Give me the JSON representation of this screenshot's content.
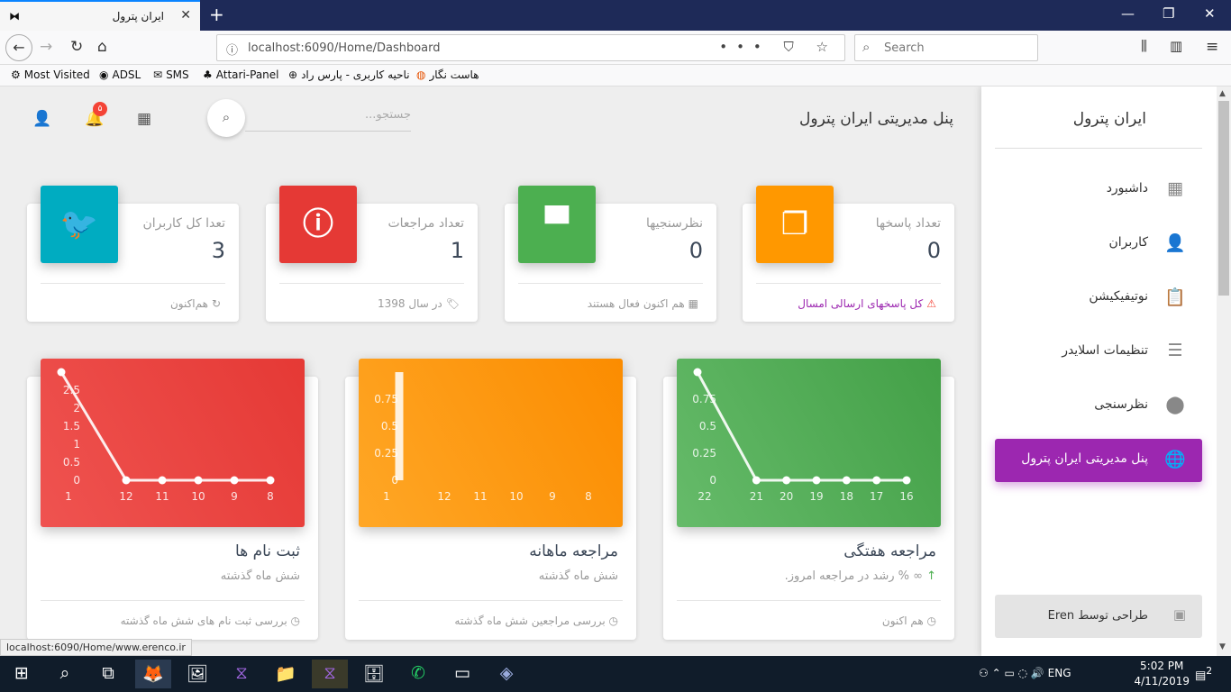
{
  "browser": {
    "tab_title": "ایران پترول",
    "tab_icon": "mask-icon",
    "new_tab": "+",
    "window_controls": [
      "—",
      "❐",
      "✕"
    ],
    "url": "localhost:6090/Home/Dashboard",
    "url_actions": "••• ⛉ ☆",
    "search_placeholder": "Search",
    "bookmarks": [
      {
        "icon": "⚙",
        "label": "Most Visited"
      },
      {
        "icon": "◉",
        "label": "ADSL"
      },
      {
        "icon": "✉",
        "label": "SMS"
      },
      {
        "icon": "♣",
        "label": "Attari-Panel"
      },
      {
        "icon": "⊕",
        "label": "ناحیه کاربری - پارس راد"
      },
      {
        "icon": "◍",
        "label": "هاست نگار"
      }
    ]
  },
  "header": {
    "title": "پنل مدیریتی ایران پترول",
    "search_placeholder": "جستجو...",
    "notification_count": "۵"
  },
  "sidebar": {
    "brand": "ایران پترول",
    "items": [
      {
        "label": "داشبورد",
        "icon": "▦"
      },
      {
        "label": "کاربران",
        "icon": "👤"
      },
      {
        "label": "نوتیفیکیشن",
        "icon": "📋"
      },
      {
        "label": "تنظیمات اسلایدر",
        "icon": "☰"
      },
      {
        "label": "نظرسنجی",
        "icon": "⬤"
      },
      {
        "label": "پنل مدیریتی ایران پترول",
        "icon": "🌐"
      }
    ],
    "credit": "طراحی توسط Eren"
  },
  "stats": [
    {
      "category": "تعداد پاسخها",
      "value": "0",
      "color": "#ff9800",
      "icon": "❐",
      "footer": "کل پاسخهای ارسالی امسال",
      "footer_icon": "⚠",
      "footer_color": "#9c27b0",
      "footer_icon_color": "#f44336"
    },
    {
      "category": "نظرسنجیها",
      "value": "0",
      "color": "#4caf50",
      "icon": "▀",
      "footer": "هم اکنون فعال هستند",
      "footer_icon": "▦",
      "footer_color": "#999",
      "footer_icon_color": "#999"
    },
    {
      "category": "تعداد مراجعات",
      "value": "1",
      "color": "#e53935",
      "icon": "ⓘ",
      "footer": "در سال 1398",
      "footer_icon": "🏷",
      "footer_color": "#999",
      "footer_icon_color": "#999"
    },
    {
      "category": "تعدا کل کاربران",
      "value": "3",
      "color": "#00acc1",
      "icon": "🐦",
      "footer": "هم‌اکنون",
      "footer_icon": "↻",
      "footer_color": "#999",
      "footer_icon_color": "#999"
    }
  ],
  "charts": [
    {
      "title": "مراجعه هفتگی",
      "subtitle": "∞ % رشد در مراجعه امروز.",
      "subtitle_icon": "↑",
      "footer": "هم اکنون",
      "footer_icon": "◷",
      "color1": "#66bb6a",
      "color2": "#43a047"
    },
    {
      "title": "مراجعه ماهانه",
      "subtitle": "شش ماه گذشته",
      "footer": "بررسی مراجعین شش ماه گذشته",
      "footer_icon": "◷",
      "color1": "#ffa726",
      "color2": "#fb8c00"
    },
    {
      "title": "ثبت نام ها",
      "subtitle": "شش ماه گذشته",
      "footer": "بررسی ثبت نام های شش ماه گذشته",
      "footer_icon": "◷",
      "color1": "#ef5350",
      "color2": "#e53935"
    }
  ],
  "chart_data": [
    {
      "type": "line",
      "categories": [
        "22",
        "21",
        "20",
        "19",
        "18",
        "17",
        "16"
      ],
      "values": [
        1,
        0,
        0,
        0,
        0,
        0,
        0
      ],
      "yticks": [
        "0",
        "0.25",
        "0.5",
        "0.75"
      ],
      "ylim": [
        0,
        1
      ]
    },
    {
      "type": "bar",
      "categories": [
        "1",
        "12",
        "11",
        "10",
        "9",
        "8"
      ],
      "values": [
        1,
        0,
        0,
        0,
        0,
        0
      ],
      "yticks": [
        "0",
        "0.25",
        "0.5",
        "0.75"
      ],
      "ylim": [
        0,
        1
      ]
    },
    {
      "type": "line",
      "categories": [
        "1",
        "12",
        "11",
        "10",
        "9",
        "8"
      ],
      "values": [
        3,
        0,
        0,
        0,
        0,
        0
      ],
      "yticks": [
        "0",
        "0.5",
        "1",
        "1.5",
        "2",
        "2.5"
      ],
      "ylim": [
        0,
        3
      ]
    }
  ],
  "status_url": "localhost:6090/Home/www.erenco.ir",
  "taskbar": {
    "apps": [
      "⊞",
      "⌕",
      "⧉",
      "🦊",
      "🖼",
      "⧖",
      "📁",
      "⧖",
      "🗄",
      "✆",
      "▭",
      "◈"
    ],
    "tray": "⚇  ⌃  ▭  ◌  🔊  ENG",
    "time": "5:02 PM",
    "date": "4/11/2019",
    "notif": "2"
  }
}
